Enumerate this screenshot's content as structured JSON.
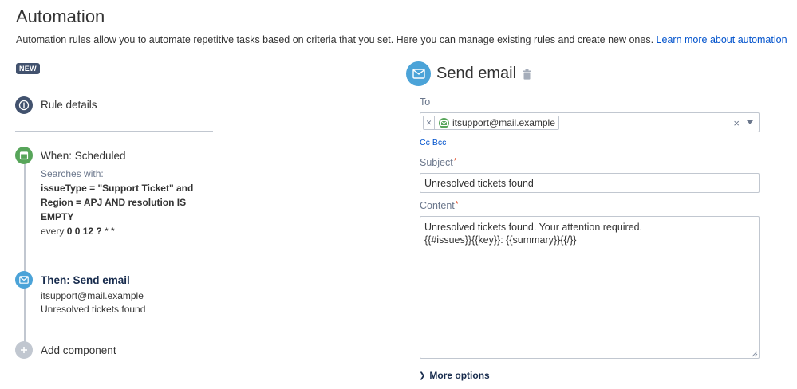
{
  "page": {
    "title": "Automation",
    "description": "Automation rules allow you to automate repetitive tasks based on criteria that you set. Here you can manage existing rules and create new ones.",
    "learn_more_link": "Learn more about automation"
  },
  "badge": {
    "new": "NEW"
  },
  "rule_tree": {
    "details": {
      "label": "Rule details",
      "icon": "info-icon"
    },
    "when": {
      "label": "When: Scheduled",
      "icon": "calendar-icon",
      "searches_with_label": "Searches with:",
      "query": "issueType = \"Support Ticket\" and Region = APJ AND resolution IS EMPTY",
      "every_label": "every",
      "cron_bold": "0 0 12 ?",
      "cron_rest": " * *"
    },
    "then": {
      "label": "Then: Send email",
      "icon": "mail-icon",
      "line1": "itsupport@mail.example",
      "line2": "Unresolved tickets found"
    },
    "add": {
      "label": "Add component",
      "icon": "plus-icon"
    }
  },
  "panel": {
    "title": "Send email",
    "icon": "mail-icon",
    "to": {
      "label": "To",
      "recipient": "itsupport@mail.example",
      "clear": "×"
    },
    "cc": "Cc",
    "bcc": "Bcc",
    "subject": {
      "label": "Subject",
      "value": "Unresolved tickets found"
    },
    "content": {
      "label": "Content",
      "line1": "Unresolved tickets found. Your attention required.",
      "line2": "{{#issues}}{{key}}: {{summary}}{{/}}"
    },
    "more_options": "More options",
    "required_mark": "*"
  },
  "colors": {
    "accent_blue": "#4ba3d8",
    "success_green": "#57a55a",
    "dark_slate": "#42526e",
    "link": "#0052cc",
    "required": "#de350b"
  }
}
